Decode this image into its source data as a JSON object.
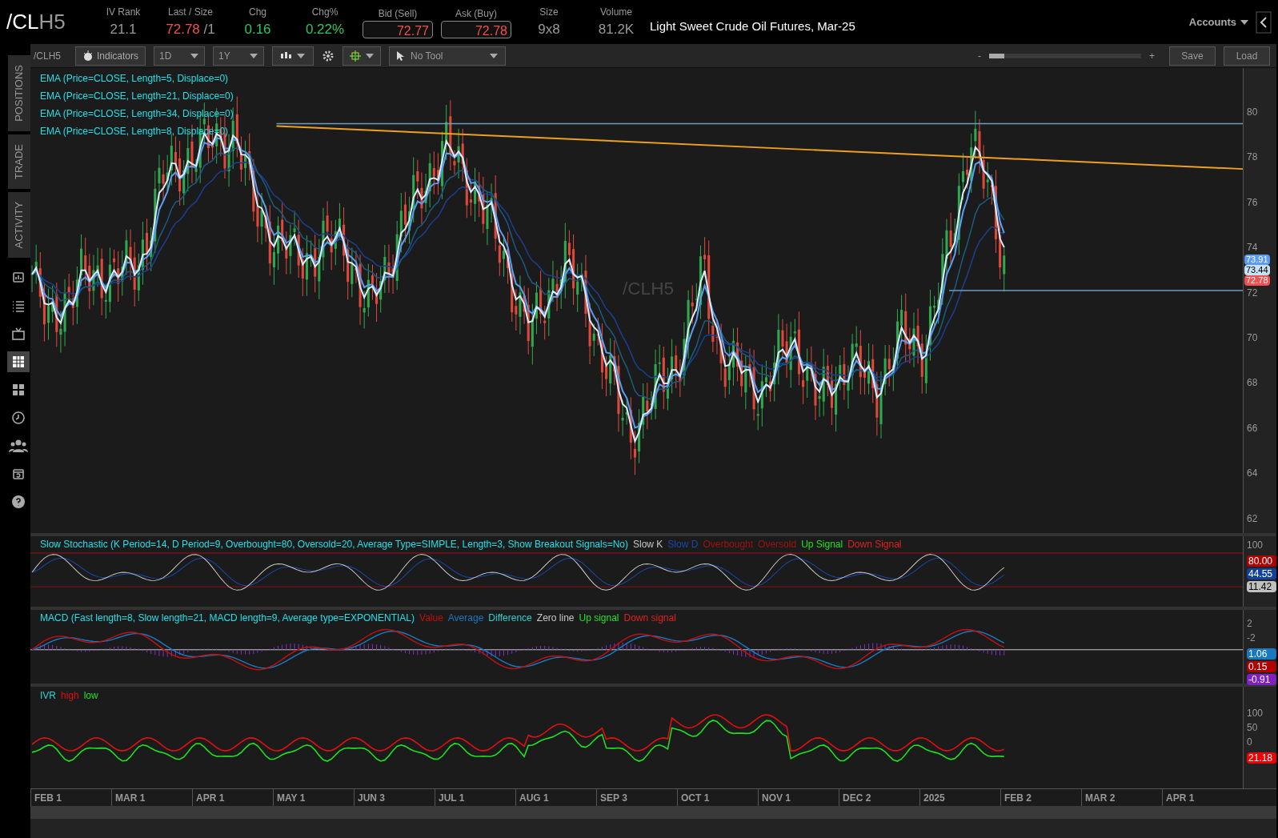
{
  "header": {
    "symbol_root": "/CL",
    "symbol_suffix": "H5",
    "quotes": [
      {
        "label": "IV Rank",
        "value": "21.1",
        "kind": "plain"
      },
      {
        "label": "Last / Size",
        "value": "72.78",
        "extra": "/1",
        "kind": "last"
      },
      {
        "label": "Chg",
        "value": "0.16",
        "kind": "up"
      },
      {
        "label": "Chg%",
        "value": "0.22%",
        "kind": "up"
      },
      {
        "label": "Bid (Sell)",
        "value": "72.77",
        "kind": "boxed"
      },
      {
        "label": "Ask (Buy)",
        "value": "72.78",
        "kind": "boxed"
      },
      {
        "label": "Size",
        "value": "9x8",
        "kind": "plain"
      },
      {
        "label": "Volume",
        "value": "81.2K",
        "kind": "plain"
      }
    ],
    "description": "Light Sweet Crude Oil Futures, Mar-25",
    "accounts": "Accounts"
  },
  "toolbar": {
    "symbol": "/CLH5",
    "indicators": "Indicators",
    "aggregation": "1D",
    "period": "1Y",
    "tool": "No Tool",
    "zoom_out": "-",
    "zoom_in": "+",
    "level": 0.1,
    "save": "Save",
    "load": "Load"
  },
  "sidebar": {
    "tabs": [
      {
        "label": "POSITIONS"
      },
      {
        "label": "TRADE"
      },
      {
        "label": "ACTIVITY"
      }
    ],
    "icons": [
      {
        "kind": "monitor",
        "selected": false
      },
      {
        "kind": "list",
        "selected": false
      },
      {
        "kind": "tv",
        "selected": false
      },
      {
        "kind": "chart",
        "selected": true
      },
      {
        "kind": "grid",
        "selected": false
      },
      {
        "kind": "clock",
        "selected": false
      },
      {
        "kind": "people",
        "selected": false
      },
      {
        "kind": "calendar",
        "selected": false
      },
      {
        "kind": "help",
        "selected": false
      }
    ]
  },
  "price_panel": {
    "studies": [
      "EMA (Price=CLOSE, Length=5, Displace=0)",
      "EMA (Price=CLOSE, Length=21, Displace=0)",
      "EMA (Price=CLOSE, Length=34, Displace=0)",
      "EMA (Price=CLOSE, Length=8, Displace=0)"
    ],
    "watermark": "/CLH5",
    "y_ticks": [
      "80",
      "78",
      "76",
      "74",
      "72",
      "70",
      "68",
      "66",
      "64",
      "62"
    ],
    "badges": [
      {
        "value": "73.91",
        "color": "#5b9bf0"
      },
      {
        "value": "73.44",
        "color": "#c8e0f4"
      },
      {
        "value": "72.78",
        "color": "#f05050"
      }
    ]
  },
  "stochastic": {
    "title": "Slow Stochastic (K Period=14, D Period=9, Overbought=80, Oversold=20, Average Type=SIMPLE, Length=3, Show Breakout Signals=No)",
    "legend": [
      {
        "label": "Slow K",
        "color": "#c8c8c8"
      },
      {
        "label": "Slow D",
        "color": "#1848b0"
      },
      {
        "label": "Overbought",
        "color": "#a01010"
      },
      {
        "label": "Oversold",
        "color": "#a01010"
      },
      {
        "label": "Up Signal",
        "color": "#20e020"
      },
      {
        "label": "Down Signal",
        "color": "#e02020"
      }
    ],
    "y_ticks": [
      "100"
    ],
    "badges": [
      {
        "value": "80.00",
        "color": "#b00000"
      },
      {
        "value": "44.55",
        "color": "#1040a0"
      },
      {
        "value": "11.42",
        "color": "#c0c0c0"
      }
    ]
  },
  "macd": {
    "title": "MACD (Fast length=8, Slow length=21, MACD length=9, Average type=EXPONENTIAL)",
    "legend": [
      {
        "label": "Value",
        "color": "#c01010"
      },
      {
        "label": "Average",
        "color": "#1878c0"
      },
      {
        "label": "Difference",
        "color": "#30d0d0"
      },
      {
        "label": "Zero line",
        "color": "#c8c8c8"
      },
      {
        "label": "Up signal",
        "color": "#20e020"
      },
      {
        "label": "Down signal",
        "color": "#e02020"
      }
    ],
    "y_ticks": [
      "2",
      "-2"
    ],
    "badges": [
      {
        "value": "1.06",
        "color": "#1878c0"
      },
      {
        "value": "0.15",
        "color": "#b00000"
      },
      {
        "value": "-0.91",
        "color": "#8020c0"
      }
    ]
  },
  "ivr": {
    "legend": [
      {
        "label": "IVR",
        "color": "#30d0d0"
      },
      {
        "label": "high",
        "color": "#e01010"
      },
      {
        "label": "low",
        "color": "#20e020"
      }
    ],
    "y_ticks": [
      "100",
      "50",
      "0"
    ],
    "badges": [
      {
        "value": "21.18",
        "color": "#f00000"
      }
    ]
  },
  "x_axis": [
    "FEB 1",
    "MAR 1",
    "APR 1",
    "MAY 1",
    "JUN 3",
    "JUL 1",
    "AUG 1",
    "SEP 3",
    "OCT 1",
    "NOV 1",
    "DEC 2",
    "2025",
    "FEB 2",
    "MAR 2",
    "APR 1"
  ]
}
